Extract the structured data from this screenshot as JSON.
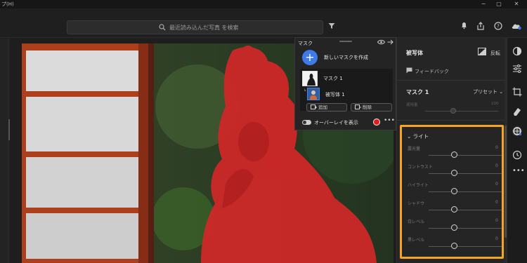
{
  "titlebar": {
    "menu": "プ(H)",
    "minimize": "−",
    "maximize": "▢",
    "close": "✕"
  },
  "toolbar": {
    "search_placeholder": "最近読み込んだ写真 を検索",
    "icons": [
      "bell-icon",
      "share-icon",
      "help-icon",
      "cloud-icon"
    ]
  },
  "mask_panel": {
    "title": "マスク",
    "create_new": "新しいマスクを作成",
    "mask_name": "マスク 1",
    "subject_name": "被写体 1",
    "add_button": "追加",
    "delete_button": "削除",
    "overlay_label": "オーバーレイを表示",
    "overlay_color": "#e21b1b",
    "more": "•••"
  },
  "right_panel": {
    "subject_title": "被写体",
    "invert_label": "反転",
    "feedback_label": "フィードバック",
    "mask_title": "マスク 1",
    "preset_label": "プリセット",
    "amount_label": "適用量",
    "amount_value": "100",
    "amount_fraction": 0.5,
    "light_section": {
      "title": "ライト",
      "sliders": [
        {
          "label": "露光量",
          "value": "0",
          "fraction": 0.5
        },
        {
          "label": "コントラスト",
          "value": "0",
          "fraction": 0.5
        },
        {
          "label": "ハイライト",
          "value": "0",
          "fraction": 0.5
        },
        {
          "label": "シャドウ",
          "value": "0",
          "fraction": 0.5
        },
        {
          "label": "白レベル",
          "value": "0",
          "fraction": 0.5
        },
        {
          "label": "黒レベル",
          "value": "0",
          "fraction": 0.5
        }
      ]
    },
    "highlight_color": "#f5a520"
  },
  "tool_strip": [
    "edit-icon",
    "sliders-icon",
    "crop-icon",
    "eraser-icon",
    "mask-icon",
    "history-icon",
    "more-icon"
  ]
}
